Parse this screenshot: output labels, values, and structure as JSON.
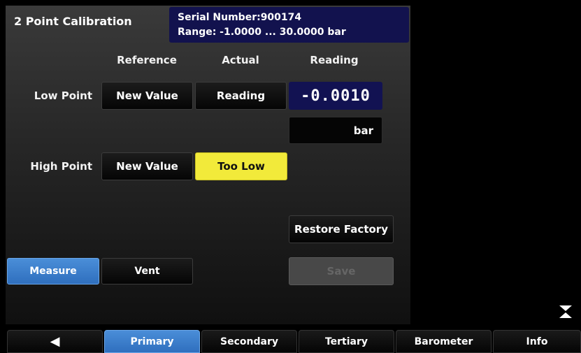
{
  "screen": {
    "title": "2 Point Calibration",
    "serial_number": "Serial Number:900174",
    "range": "Range: -1.0000 ... 30.0000 bar"
  },
  "columns": {
    "reference": "Reference",
    "actual": "Actual",
    "reading": "Reading"
  },
  "low_point": {
    "label": "Low Point",
    "reference_button": "New Value",
    "actual_button": "Reading",
    "reading_value": "-0.0010",
    "unit": "bar"
  },
  "high_point": {
    "label": "High Point",
    "reference_button": "New Value",
    "actual_button": "Too Low"
  },
  "actions": {
    "restore_factory": "Restore Factory",
    "save": "Save",
    "measure": "Measure",
    "vent": "Vent"
  },
  "tabs": [
    {
      "label": "◀"
    },
    {
      "label": "Primary"
    },
    {
      "label": "Secondary"
    },
    {
      "label": "Tertiary"
    },
    {
      "label": "Barometer"
    },
    {
      "label": "Info"
    }
  ],
  "colors": {
    "accent_blue": "#3a7fd0",
    "reading_bg": "#121252",
    "warning_yellow": "#f2ea3a"
  },
  "icons": {
    "collapse": "collapse-arrows-icon",
    "back": "back-arrow-icon"
  }
}
